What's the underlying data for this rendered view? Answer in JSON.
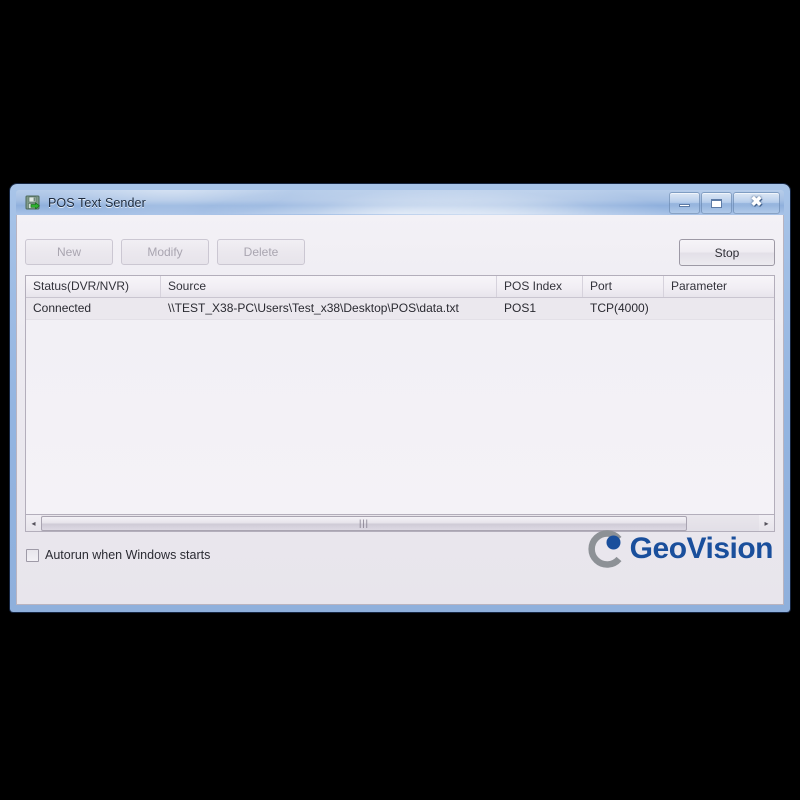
{
  "window": {
    "title": "POS Text Sender",
    "icon": "save-disk-green-arrow-icon",
    "controls": {
      "minimize": "minimize-icon",
      "maximize": "maximize-icon",
      "close": "close-icon"
    }
  },
  "toolbar": {
    "new_label": "New",
    "modify_label": "Modify",
    "delete_label": "Delete",
    "action_label": "Stop",
    "new_enabled": false,
    "modify_enabled": false,
    "delete_enabled": false,
    "action_enabled": true
  },
  "listview": {
    "columns": [
      "Status(DVR/NVR)",
      "Source",
      "POS Index",
      "Port",
      "Parameter"
    ],
    "rows": [
      {
        "status": "Connected",
        "source": "\\\\TEST_X38-PC\\Users\\Test_x38\\Desktop\\POS\\data.txt",
        "pos_index": "POS1",
        "port": "TCP(4000)",
        "parameter": ""
      }
    ]
  },
  "scrollbar": {
    "left_arrow": "◂",
    "right_arrow": "▸",
    "grip": "⦀"
  },
  "options": {
    "autorun_label": "Autorun when Windows starts",
    "autorun_checked": false
  },
  "branding": {
    "name": "GeoVision",
    "mark": "geovision-c-mark-icon",
    "accent_blue": "#1a4f9c",
    "mark_gray": "#8d9196"
  }
}
